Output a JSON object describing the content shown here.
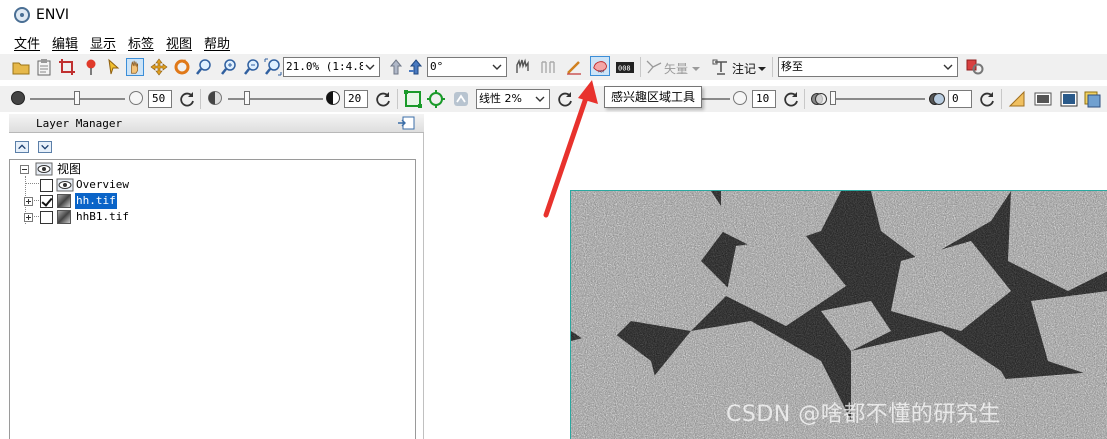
{
  "window": {
    "title": "ENVI"
  },
  "menu": [
    "文件",
    "编辑",
    "显示",
    "标签",
    "视图",
    "帮助"
  ],
  "toolbar1": {
    "zoom_value": "21.0% (1:4.8)",
    "rotation_value": "0°",
    "vector_label": "矢量",
    "annotation_label": "注记",
    "goto_value": "移至"
  },
  "toolbar2": {
    "brightness_value": "50",
    "contrast_value": "20",
    "stretch_value": "线性 2%",
    "sharpen_value": "10",
    "transparency_value": "0"
  },
  "tooltip": {
    "text": "感兴趣区域工具"
  },
  "layer_manager": {
    "title": "Layer Manager",
    "root": "视图",
    "items": [
      {
        "label": "Overview",
        "checked": false,
        "selected": false
      },
      {
        "label": "hh.tif",
        "checked": true,
        "selected": true
      },
      {
        "label": "hhB1.tif",
        "checked": false,
        "selected": false
      }
    ]
  },
  "watermark": "CSDN @啥都不懂的研究生",
  "colors": {
    "accent_red": "#e8322d",
    "selection": "#0a64c8",
    "image_border": "#2aa8a0"
  }
}
